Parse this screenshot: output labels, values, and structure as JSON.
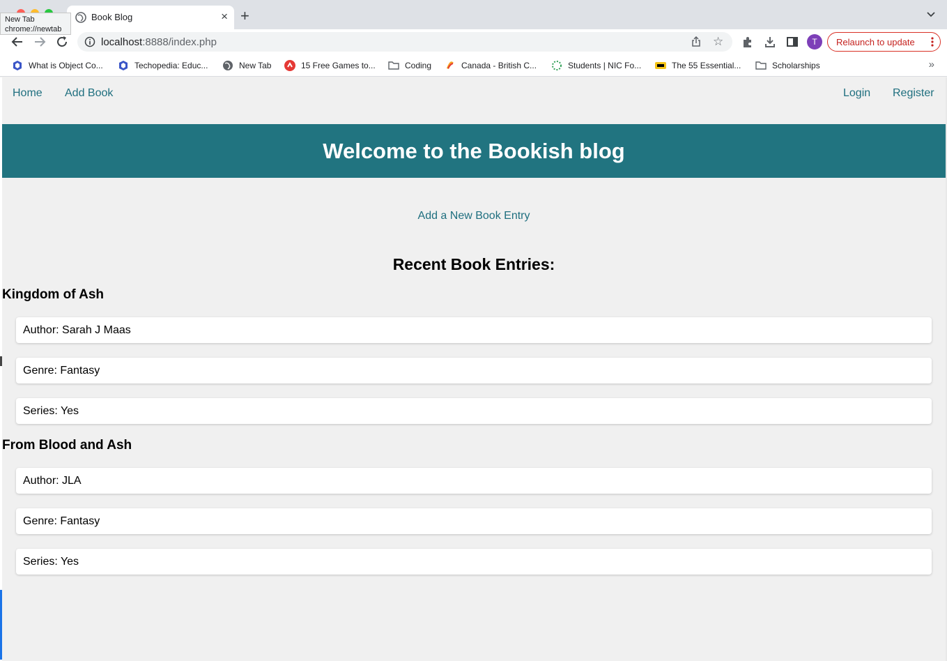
{
  "browser": {
    "tab_title": "Book Blog",
    "tooltip_title": "New Tab",
    "tooltip_url": "chrome://newtab",
    "url_host": "localhost",
    "url_path": ":8888/index.php",
    "avatar_letter": "T",
    "relaunch_label": "Relaunch to update",
    "bookmarks": [
      {
        "label": "What is Object Co...",
        "icon": "site-icon"
      },
      {
        "label": "Techopedia: Educ...",
        "icon": "site-icon"
      },
      {
        "label": "New Tab",
        "icon": "globe-icon"
      },
      {
        "label": "15 Free Games to...",
        "icon": "site-icon"
      },
      {
        "label": "Coding",
        "icon": "folder-icon"
      },
      {
        "label": "Canada - British C...",
        "icon": "site-icon"
      },
      {
        "label": "Students | NIC Fo...",
        "icon": "spinner-icon"
      },
      {
        "label": "The 55 Essential...",
        "icon": "imdb-icon"
      },
      {
        "label": "Scholarships",
        "icon": "folder-icon"
      }
    ],
    "bookmarks_more": "»"
  },
  "site": {
    "nav": {
      "home": "Home",
      "add_book": "Add Book",
      "login": "Login",
      "register": "Register"
    },
    "hero_title": "Welcome to the Bookish blog",
    "add_entry_link": "Add a New Book Entry",
    "recent_heading": "Recent Book Entries:",
    "books": [
      {
        "title": "Kingdom of Ash",
        "author": "Author: Sarah J Maas",
        "genre": "Genre: Fantasy",
        "series": "Series: Yes"
      },
      {
        "title": "From Blood and Ash",
        "author": "Author: JLA",
        "genre": "Genre: Fantasy",
        "series": "Series: Yes"
      }
    ]
  },
  "colors": {
    "accent": "#217480",
    "link": "#1f6f7f",
    "page_bg": "#f0f0f0",
    "relaunch": "#c5221f"
  }
}
